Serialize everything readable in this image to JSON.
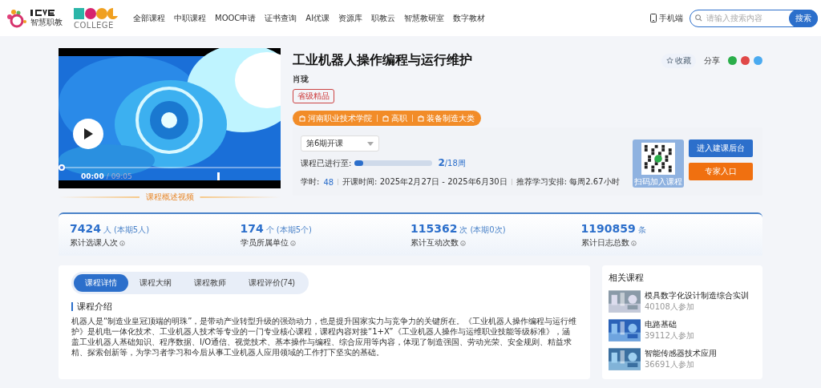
{
  "header": {
    "logo_text": "智慧职教",
    "college_logo": "COLLEGE",
    "nav": [
      {
        "label": "全部课程",
        "selected": false
      },
      {
        "label": "中职课程",
        "selected": false
      },
      {
        "label": "MOOC申请",
        "selected": false
      },
      {
        "label": "证书查询",
        "selected": false
      },
      {
        "label": "AI优课",
        "selected": false
      },
      {
        "label": "资源库",
        "selected": false
      },
      {
        "label": "职教云",
        "selected": false
      },
      {
        "label": "智慧教研室",
        "selected": false
      },
      {
        "label": "数字教材",
        "selected": false
      }
    ],
    "mobile": "手机端",
    "search": {
      "placeholder": "请输入搜索内容",
      "button": "搜索"
    }
  },
  "video": {
    "current": "00:00",
    "duration": "/ 09:05",
    "level": 0,
    "caption": "课程概述视频"
  },
  "course": {
    "title": "工业机器人操作编程与运行维护",
    "teacher": "肖珑",
    "badge": "省级精品",
    "tags": [
      "河南职业技术学院",
      "高职",
      "装备制造大类"
    ],
    "favorite": "收藏",
    "share": "分享",
    "session": "第6期开课",
    "progress_label": "课程已进行至:",
    "level": 0.111,
    "week_current": "2",
    "week_total": "/18周",
    "hours_label": "学时:",
    "hours": "48",
    "time": "开课时间: 2025年2月27日 - 2025年6月30日",
    "schedule": "推荐学习安排: 每周2.67小时",
    "qr_caption": "扫码加入课程",
    "buttons": [
      "进入建课后台",
      "专家入口"
    ]
  },
  "stats": [
    {
      "value": "7424",
      "unit": "人",
      "extra": "(本期5人)",
      "label": "累计选课人次"
    },
    {
      "value": "174",
      "unit": "个",
      "extra": "(本期5个)",
      "label": "学员所属单位"
    },
    {
      "value": "115362",
      "unit": "次",
      "extra": "(本期0次)",
      "label": "累计互动次数"
    },
    {
      "value": "1190859",
      "unit": "条",
      "label": "累计日志总数"
    }
  ],
  "tabs": [
    {
      "label": "课程详情",
      "selected": true
    },
    {
      "label": "课程大纲",
      "selected": false
    },
    {
      "label": "课程教师",
      "selected": false
    },
    {
      "label": "课程评价(74)",
      "selected": false
    }
  ],
  "intro": {
    "heading": "课程介绍",
    "text": "机器人是“制造业皇冠顶端的明珠”，是带动产业转型升级的强劲动力，也是提升国家实力与竞争力的关键所在。《工业机器人操作编程与运行维护》是机电一体化技术、工业机器人技术等专业的一门专业核心课程，课程内容对接“1+X”《工业机器人操作与运维职业技能等级标准》，涵盖工业机器人基础知识、程序数据、I/O通信、视觉技术、基本操作与编程、综合应用等内容，体现了制造强国、劳动光荣、安全规则、精益求精、探索创新等，为学习者学习和今后从事工业机器人应用领域的工作打下坚实的基础。"
  },
  "related": {
    "title": "相关课程",
    "items": [
      {
        "name": "模具数字化设计制造综合实训",
        "count": "40108人参加"
      },
      {
        "name": "电路基础",
        "count": "39112人参加"
      },
      {
        "name": "智能传感器技术应用",
        "count": "36691人参加"
      }
    ]
  }
}
